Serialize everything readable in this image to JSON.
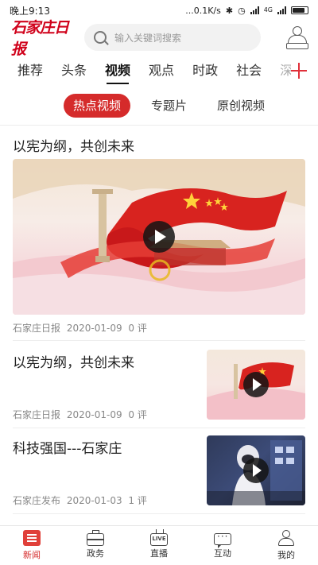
{
  "status_bar": {
    "time": "晚上9:13",
    "network_speed": "...0.1K/s",
    "network_type": "4G"
  },
  "header": {
    "logo_text": "石家庄日报",
    "search_placeholder": "输入关键词搜索"
  },
  "categories": [
    "推荐",
    "头条",
    "视频",
    "观点",
    "时政",
    "社会",
    "深"
  ],
  "active_category": "视频",
  "sub_tabs": [
    "热点视频",
    "专题片",
    "原创视频"
  ],
  "active_sub_tab": "热点视频",
  "feed": {
    "featured": {
      "title": "以宪为纲，共创未来",
      "source": "石家庄日报",
      "date": "2020-01-09",
      "comments": "0 评"
    },
    "items": [
      {
        "title": "以宪为纲，共创未来",
        "source": "石家庄日报",
        "date": "2020-01-09",
        "comments": "0 评"
      },
      {
        "title": "科技强国---石家庄",
        "source": "石家庄发布",
        "date": "2020-01-03",
        "comments": "1 评"
      }
    ]
  },
  "bottom_nav": [
    {
      "label": "新闻",
      "icon": "news-icon",
      "active": true
    },
    {
      "label": "政务",
      "icon": "briefcase-icon",
      "active": false
    },
    {
      "label": "直播",
      "icon": "live-tv-icon",
      "active": false
    },
    {
      "label": "互动",
      "icon": "chat-icon",
      "active": false
    },
    {
      "label": "我的",
      "icon": "user-icon",
      "active": false
    }
  ],
  "live_icon_text": "LIVE",
  "colors": {
    "accent": "#d52b2b",
    "logo": "#d0021b",
    "add_icon": "#e0303a"
  }
}
